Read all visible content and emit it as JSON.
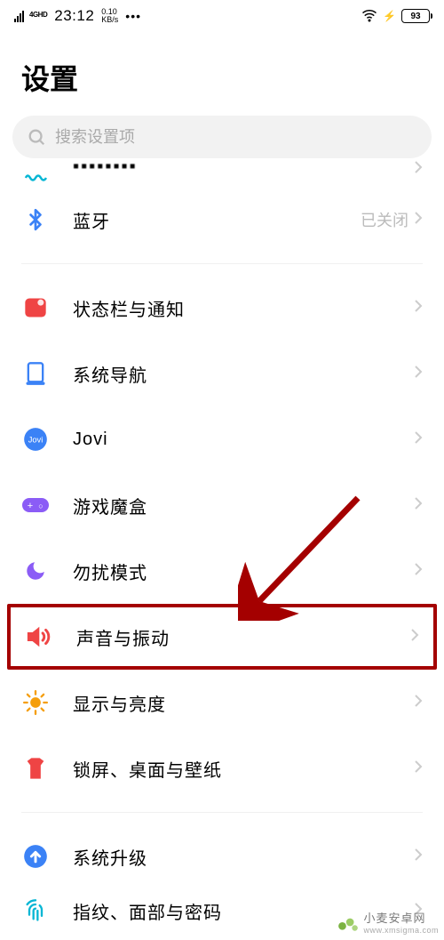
{
  "status": {
    "fourg": "4GHD",
    "time": "23:12",
    "net_speed": "0.10",
    "net_unit": "KB/s",
    "dots": "•••",
    "battery": "93"
  },
  "page": {
    "title": "设置"
  },
  "search": {
    "placeholder": "搜索设置项"
  },
  "rows": {
    "bluetooth": {
      "label": "蓝牙",
      "value": "已关闭"
    },
    "statusbar": {
      "label": "状态栏与通知"
    },
    "sysnav": {
      "label": "系统导航"
    },
    "jovi": {
      "label": "Jovi"
    },
    "gamebox": {
      "label": "游戏魔盒"
    },
    "dnd": {
      "label": "勿扰模式"
    },
    "sound": {
      "label": "声音与振动"
    },
    "display": {
      "label": "显示与亮度"
    },
    "lock": {
      "label": "锁屏、桌面与壁纸"
    },
    "upgrade": {
      "label": "系统升级"
    },
    "biometric": {
      "label": "指纹、面部与密码"
    }
  },
  "watermark": {
    "text": "小麦安卓网",
    "sub": "www.xmsigma.com"
  },
  "icons": {
    "bluetooth_color": "#3b82f6",
    "statusbar_color": "#ef4444",
    "sysnav_color": "#3b82f6",
    "jovi_color": "#3b82f6",
    "gamebox_color": "#8b5cf6",
    "dnd_color": "#8b5cf6",
    "sound_color": "#ef4444",
    "display_color": "#f59e0b",
    "lock_color": "#ef4444",
    "upgrade_color": "#3b82f6",
    "biometric_color": "#06b6d4",
    "highlight_color": "#a40000"
  }
}
